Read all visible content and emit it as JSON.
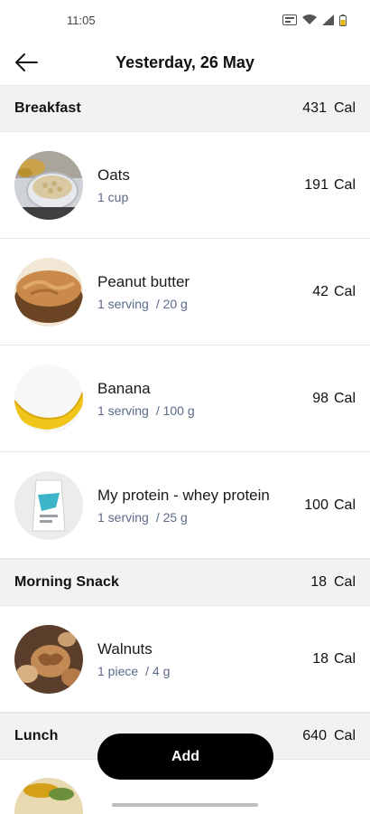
{
  "status_bar": {
    "time": "11:05"
  },
  "header": {
    "title": "Yesterday, 26 May"
  },
  "sections": [
    {
      "name": "Breakfast",
      "calories": "431",
      "unit": "Cal",
      "items": [
        {
          "name": "Oats",
          "serving": "1 cup",
          "amount": "",
          "calories": "191",
          "unit": "Cal",
          "image": "oats"
        },
        {
          "name": "Peanut butter",
          "serving": "1 serving",
          "amount": "/ 20 g",
          "calories": "42",
          "unit": "Cal",
          "image": "peanut-butter"
        },
        {
          "name": "Banana",
          "serving": "1 serving",
          "amount": "/ 100 g",
          "calories": "98",
          "unit": "Cal",
          "image": "banana"
        },
        {
          "name": "My protein - whey protein",
          "serving": "1 serving",
          "amount": "/ 25 g",
          "calories": "100",
          "unit": "Cal",
          "image": "protein-pouch"
        }
      ]
    },
    {
      "name": "Morning Snack",
      "calories": "18",
      "unit": "Cal",
      "items": [
        {
          "name": "Walnuts",
          "serving": "1 piece",
          "amount": "/ 4 g",
          "calories": "18",
          "unit": "Cal",
          "image": "walnuts"
        }
      ]
    },
    {
      "name": "Lunch",
      "calories": "640",
      "unit": "Cal",
      "items": []
    }
  ],
  "add_button": {
    "label": "Add"
  }
}
